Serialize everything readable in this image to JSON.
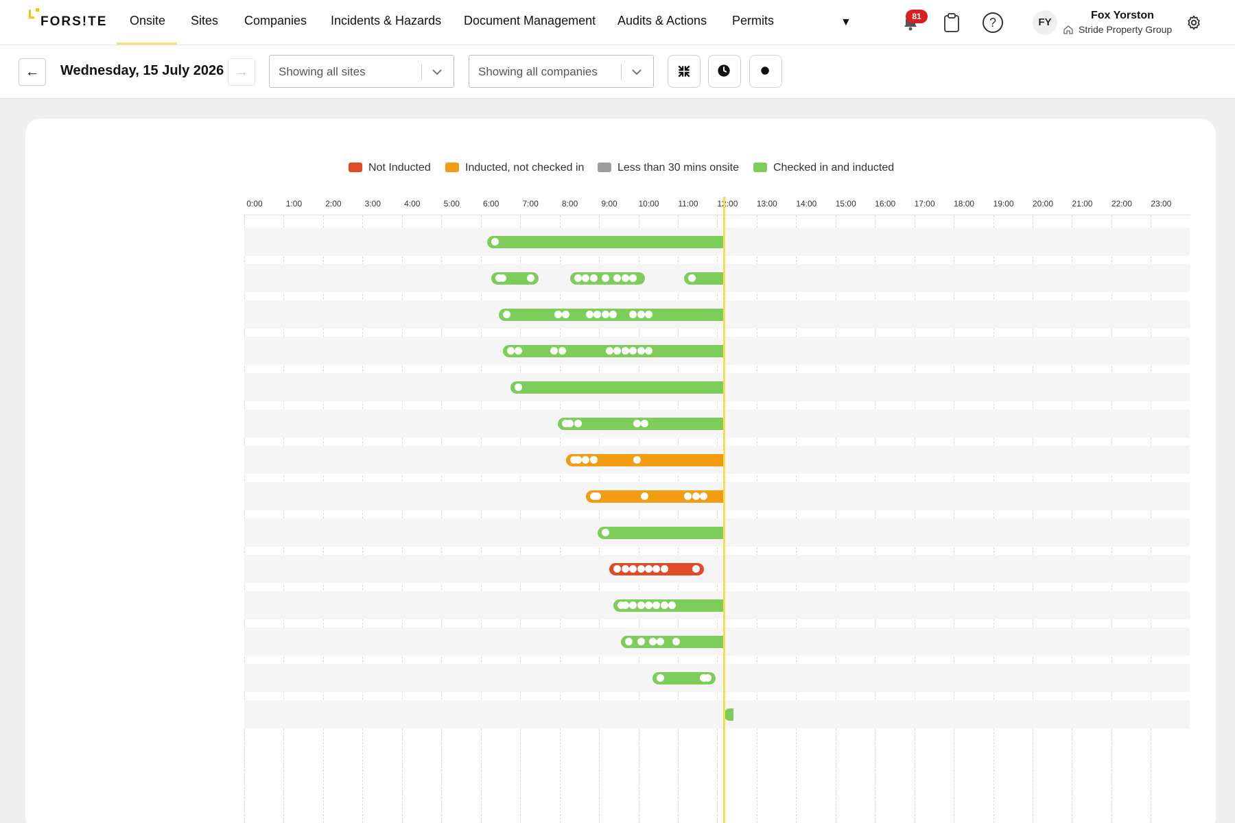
{
  "app": {
    "logo_text": "FORS!TE"
  },
  "nav": {
    "items": [
      "Onsite",
      "Sites",
      "Companies",
      "Incidents & Hazards",
      "Document Management",
      "Audits & Actions",
      "Permits"
    ],
    "active": "Onsite"
  },
  "header": {
    "notification_count": "81",
    "avatar_initials": "FY",
    "user_name": "Fox Yorston",
    "user_org": "Stride Property Group"
  },
  "toolbar": {
    "date": "Wednesday, 15 July 2026",
    "sites_select": "Showing all sites",
    "companies_select": "Showing all companies"
  },
  "colors": {
    "not_inducted": "#e24a26",
    "inducted_not_checked_in": "#f39c12",
    "less_than_30": "#9e9e9e",
    "checked_in_inducted": "#7dcd5a",
    "now_line": "#f5e04a"
  },
  "legend": [
    {
      "label": "Not Inducted",
      "color": "#e24a26"
    },
    {
      "label": "Inducted, not checked in",
      "color": "#f39c12"
    },
    {
      "label": "Less than 30 mins onsite",
      "color": "#9e9e9e"
    },
    {
      "label": "Checked in and inducted",
      "color": "#7dcd5a"
    }
  ],
  "timeline": {
    "hours": [
      "0:00",
      "1:00",
      "2:00",
      "3:00",
      "4:00",
      "5:00",
      "6:00",
      "7:00",
      "8:00",
      "9:00",
      "10:00",
      "11:00",
      "12:00",
      "13:00",
      "14:00",
      "15:00",
      "16:00",
      "17:00",
      "18:00",
      "19:00",
      "20:00",
      "21:00",
      "22:00",
      "23:00"
    ],
    "now": 11.9,
    "rows": [
      {
        "status": "checked_in_inducted",
        "segments": [
          [
            5.9,
            11.9
          ]
        ],
        "dots": [
          6.1
        ]
      },
      {
        "status": "checked_in_inducted",
        "segments": [
          [
            6.0,
            7.2
          ],
          [
            8.0,
            9.9
          ],
          [
            10.9,
            11.9
          ]
        ],
        "dots": [
          6.2,
          6.3,
          7.0,
          8.2,
          8.4,
          8.6,
          8.9,
          9.2,
          9.4,
          9.6,
          11.1
        ]
      },
      {
        "status": "checked_in_inducted",
        "segments": [
          [
            6.2,
            11.9
          ]
        ],
        "dots": [
          6.4,
          7.7,
          7.9,
          8.5,
          8.7,
          8.9,
          9.1,
          9.6,
          9.8,
          10.0
        ]
      },
      {
        "status": "checked_in_inducted",
        "segments": [
          [
            6.3,
            11.9
          ]
        ],
        "dots": [
          6.5,
          6.7,
          7.6,
          7.8,
          9.0,
          9.2,
          9.4,
          9.6,
          9.8,
          10.0
        ]
      },
      {
        "status": "checked_in_inducted",
        "segments": [
          [
            6.5,
            11.9
          ]
        ],
        "dots": [
          6.7
        ]
      },
      {
        "status": "checked_in_inducted",
        "segments": [
          [
            7.7,
            11.9
          ]
        ],
        "dots": [
          7.9,
          8.0,
          8.2,
          9.7,
          9.9
        ]
      },
      {
        "status": "inducted_not_checked_in",
        "segments": [
          [
            7.9,
            11.9
          ]
        ],
        "dots": [
          8.1,
          8.2,
          8.4,
          8.6,
          9.7
        ]
      },
      {
        "status": "inducted_not_checked_in",
        "segments": [
          [
            8.4,
            11.9
          ]
        ],
        "dots": [
          8.6,
          8.7,
          9.9,
          11.0,
          11.2,
          11.4
        ]
      },
      {
        "status": "checked_in_inducted",
        "segments": [
          [
            8.7,
            11.9
          ]
        ],
        "dots": [
          8.9
        ]
      },
      {
        "status": "not_inducted",
        "segments": [
          [
            9.0,
            11.4
          ]
        ],
        "dots": [
          9.2,
          9.4,
          9.6,
          9.8,
          10.0,
          10.2,
          10.4,
          11.2
        ]
      },
      {
        "status": "checked_in_inducted",
        "segments": [
          [
            9.1,
            11.9
          ]
        ],
        "dots": [
          9.3,
          9.4,
          9.6,
          9.8,
          10.0,
          10.2,
          10.4,
          10.6
        ]
      },
      {
        "status": "checked_in_inducted",
        "segments": [
          [
            9.3,
            11.9
          ]
        ],
        "dots": [
          9.5,
          9.8,
          10.1,
          10.3,
          10.7
        ]
      },
      {
        "status": "checked_in_inducted",
        "segments": [
          [
            10.1,
            11.7
          ]
        ],
        "dots": [
          10.3,
          11.4,
          11.5
        ]
      },
      {
        "status": "checked_in_inducted",
        "segments": [
          [
            11.9,
            12.0
          ]
        ],
        "dots": []
      }
    ]
  }
}
